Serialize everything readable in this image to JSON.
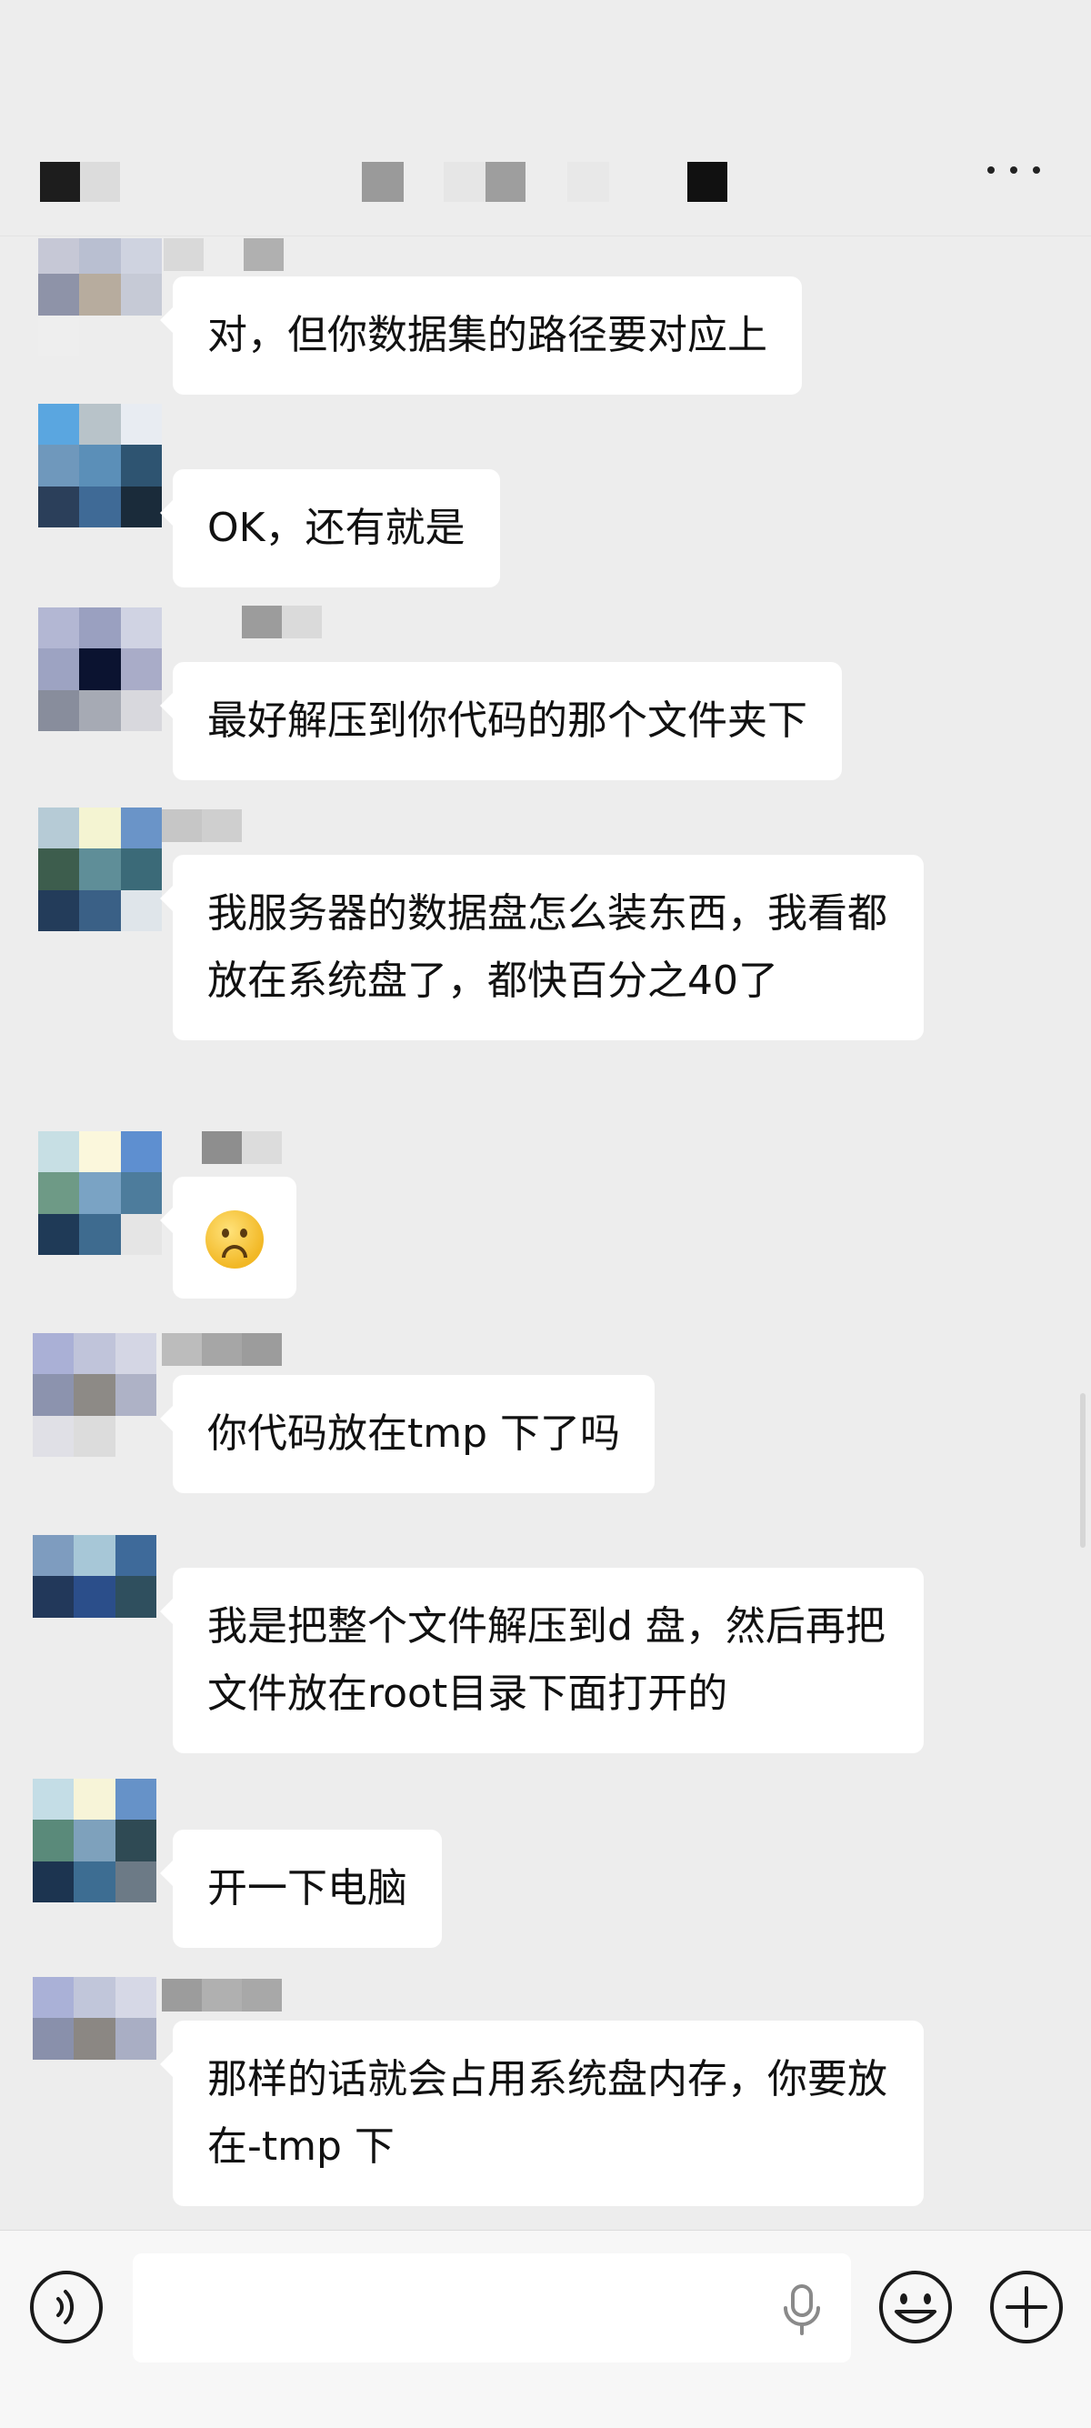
{
  "colors": {
    "background": "#ededed",
    "bubble": "#ffffff",
    "input_bar": "#f7f7f7",
    "icon": "#1a1a1a"
  },
  "header": {
    "more_icon": "ellipsis-icon"
  },
  "messages": [
    {
      "text": "对，但你数据集的路径要对应上"
    },
    {
      "text": "OK，还有就是"
    },
    {
      "text": "最好解压到你代码的那个文件夹下"
    },
    {
      "text": "我服务器的数据盘怎么装东西，我看都放在系统盘了，都快百分之40了"
    },
    {
      "text": "",
      "emoji": "frowning-face-emoji"
    },
    {
      "text": "你代码放在tmp 下了吗"
    },
    {
      "text": "我是把整个文件解压到d 盘，然后再把文件放在root目录下面打开的"
    },
    {
      "text": "开一下电脑"
    },
    {
      "text": "那样的话就会占用系统盘内存，你要放在-tmp 下"
    }
  ],
  "input_bar": {
    "voice_icon": "voice-icon",
    "input_placeholder": "",
    "mic_icon": "microphone-icon",
    "emoji_icon": "smiley-icon",
    "plus_icon": "plus-icon"
  }
}
